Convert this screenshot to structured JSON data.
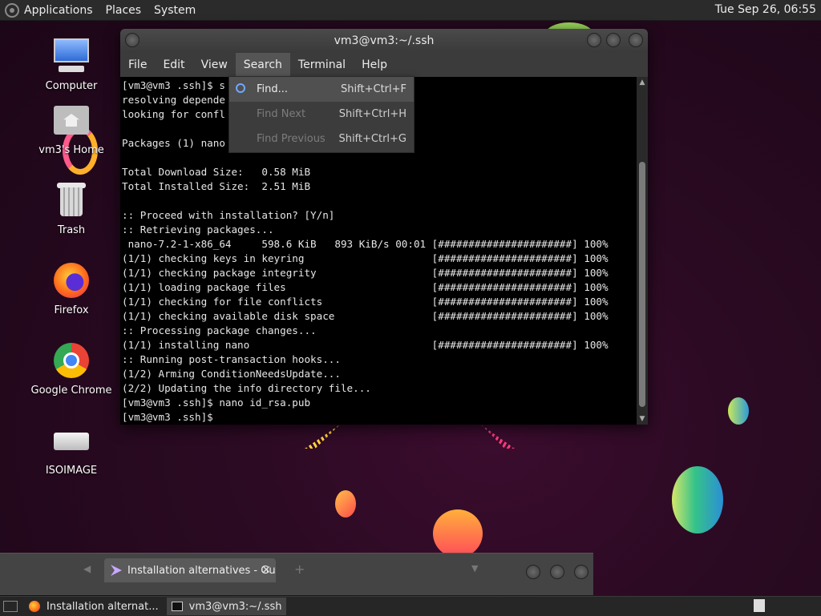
{
  "top_panel": {
    "menus": [
      "Applications",
      "Places",
      "System"
    ],
    "clock": "Tue Sep 26, 06:55"
  },
  "desktop_icons": [
    {
      "label": "Computer",
      "icon": "computer-icon"
    },
    {
      "label": "vm3's Home",
      "icon": "home-folder-icon"
    },
    {
      "label": "Trash",
      "icon": "trash-icon"
    },
    {
      "label": "Firefox",
      "icon": "firefox-icon"
    },
    {
      "label": "Google Chrome",
      "icon": "chrome-icon"
    },
    {
      "label": "ISOIMAGE",
      "icon": "drive-icon"
    }
  ],
  "terminal": {
    "title": "vm3@vm3:~/.ssh",
    "menu": [
      "File",
      "Edit",
      "View",
      "Search",
      "Terminal",
      "Help"
    ],
    "active_menu": "Search",
    "lines": [
      "[vm3@vm3 .ssh]$ s",
      "resolving depende",
      "looking for confl",
      "",
      "Packages (1) nano",
      "",
      "Total Download Size:   0.58 MiB",
      "Total Installed Size:  2.51 MiB",
      "",
      ":: Proceed with installation? [Y/n]",
      ":: Retrieving packages...",
      " nano-7.2-1-x86_64     598.6 KiB   893 KiB/s 00:01 [######################] 100%",
      "(1/1) checking keys in keyring                     [######################] 100%",
      "(1/1) checking package integrity                   [######################] 100%",
      "(1/1) loading package files                        [######################] 100%",
      "(1/1) checking for file conflicts                  [######################] 100%",
      "(1/1) checking available disk space                [######################] 100%",
      ":: Processing package changes...",
      "(1/1) installing nano                              [######################] 100%",
      ":: Running post-transaction hooks...",
      "(1/2) Arming ConditionNeedsUpdate...",
      "(2/2) Updating the info directory file...",
      "[vm3@vm3 .ssh]$ nano id_rsa.pub",
      "[vm3@vm3 .ssh]$"
    ]
  },
  "search_menu": {
    "items": [
      {
        "label": "Find...",
        "shortcut": "Shift+Ctrl+F",
        "enabled": true
      },
      {
        "label": "Find Next",
        "shortcut": "Shift+Ctrl+H",
        "enabled": false
      },
      {
        "label": "Find Previous",
        "shortcut": "Shift+Ctrl+G",
        "enabled": false
      }
    ]
  },
  "browser_window": {
    "tab_title": "Installation alternatives - Gu"
  },
  "taskbar": {
    "tasks": [
      {
        "label": "Installation alternat...",
        "icon": "firefox-icon"
      },
      {
        "label": "vm3@vm3:~/.ssh",
        "icon": "terminal-icon"
      }
    ]
  },
  "colors": {
    "panel_bg": "#2b2b2b",
    "terminal_bg": "#000000",
    "terminal_fg": "#e6e6e6",
    "accent": "#6fa8ff"
  }
}
